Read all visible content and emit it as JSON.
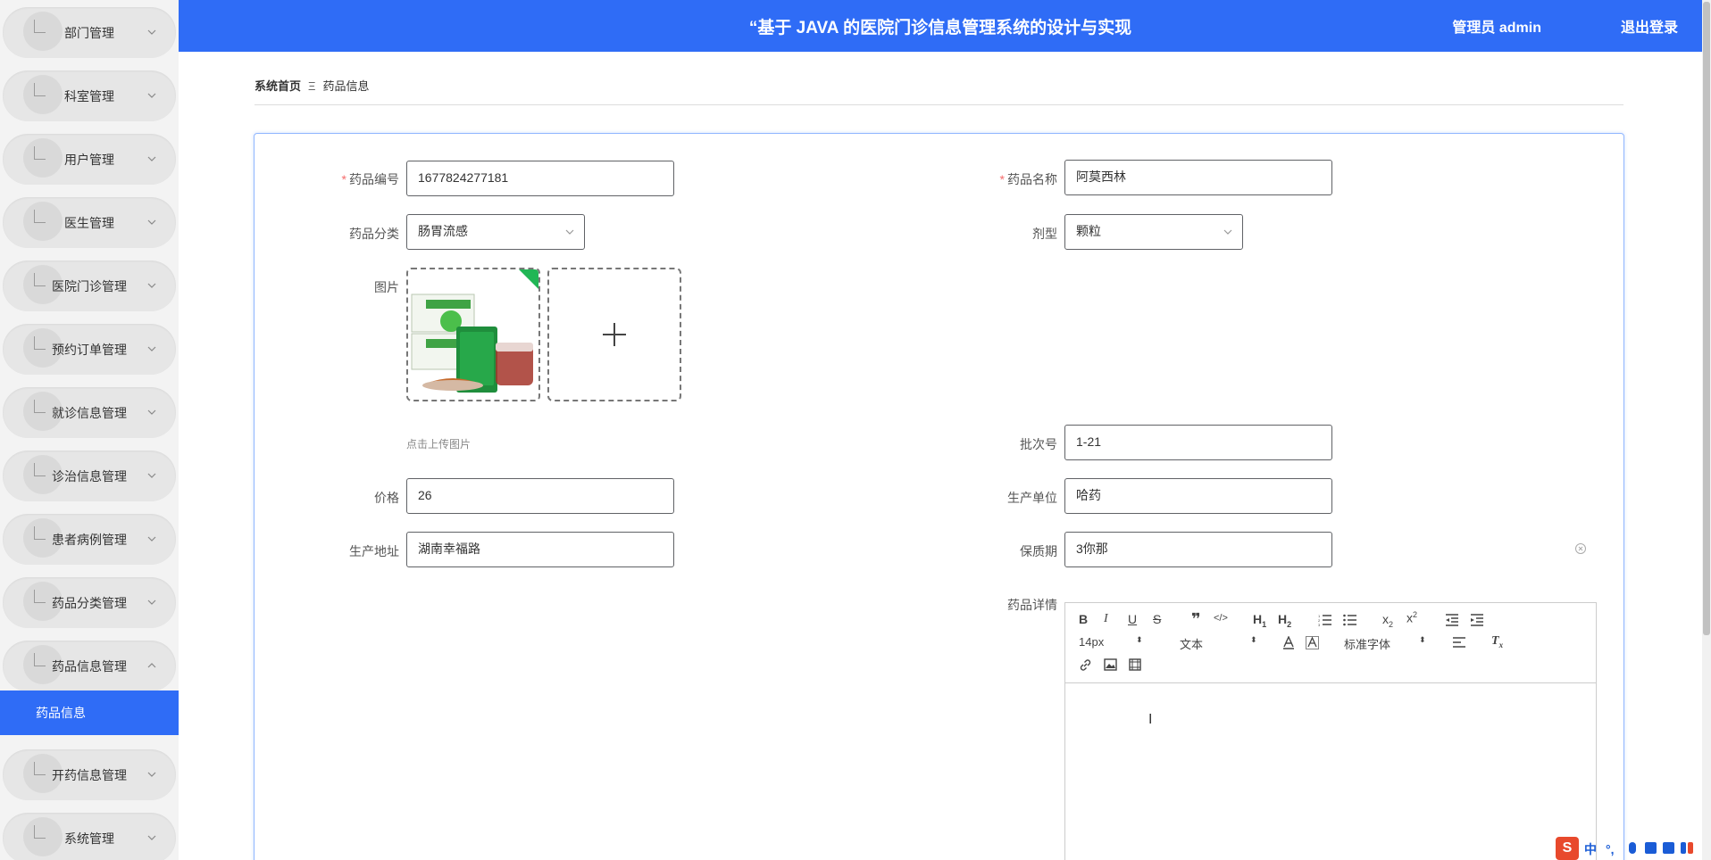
{
  "header": {
    "title": "“基于 JAVA 的医院门诊信息管理系统的设计与实现",
    "user": "管理员 admin",
    "logout": "退出登录"
  },
  "sidebar": {
    "items": [
      {
        "label": "部门管理"
      },
      {
        "label": "科室管理"
      },
      {
        "label": "用户管理"
      },
      {
        "label": "医生管理"
      },
      {
        "label": "医院门诊管理"
      },
      {
        "label": "预约订单管理"
      },
      {
        "label": "就诊信息管理"
      },
      {
        "label": "诊治信息管理"
      },
      {
        "label": "患者病例管理"
      },
      {
        "label": "药品分类管理"
      },
      {
        "label": "药品信息管理"
      },
      {
        "label": "开药信息管理"
      },
      {
        "label": "系统管理"
      }
    ],
    "active_sub": "药品信息"
  },
  "breadcrumb": {
    "home": "系统首页",
    "sep": "Ξ",
    "current": "药品信息"
  },
  "form": {
    "code_label": "药品编号",
    "code_value": "1677824277181",
    "name_label": "药品名称",
    "name_value": "阿莫西林",
    "category_label": "药品分类",
    "category_value": "肠胃流感",
    "form_label": "剂型",
    "form_value": "颗粒",
    "image_label": "图片",
    "image_hint": "点击上传图片",
    "batch_label": "批次号",
    "batch_value": "1-21",
    "price_label": "价格",
    "price_value": "26",
    "maker_label": "生产单位",
    "maker_value": "哈药",
    "address_label": "生产地址",
    "address_value": "湖南幸福路",
    "shelf_label": "保质期",
    "shelf_value": "3你那",
    "detail_label": "药品详情"
  },
  "editor": {
    "font_size": "14px",
    "paragraph": "文本",
    "font_family": "标准字体"
  },
  "ime": {
    "logo": "S",
    "lang": "中"
  },
  "colors": {
    "primary": "#2f6cf6",
    "required": "#f56c6c"
  }
}
